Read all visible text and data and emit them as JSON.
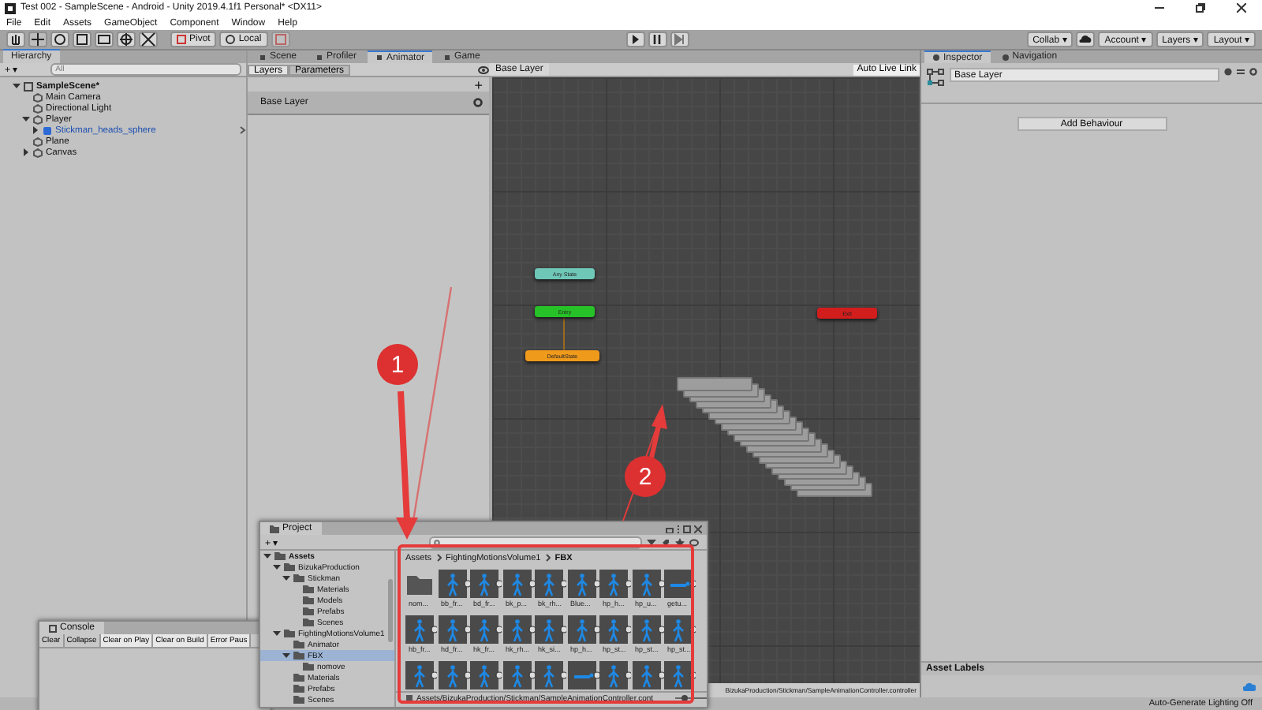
{
  "window": {
    "title": "Test 002 - SampleScene - Android - Unity 2019.4.1f1 Personal* <DX11>"
  },
  "menu": [
    "File",
    "Edit",
    "Assets",
    "GameObject",
    "Component",
    "Window",
    "Help"
  ],
  "toolbar": {
    "pivot": "Pivot",
    "local": "Local",
    "collab": "Collab ▾",
    "account": "Account ▾",
    "layers": "Layers ▾",
    "layout": "Layout ▾"
  },
  "hierarchy": {
    "title": "Hierarchy",
    "add": "+ ▾",
    "search_placeholder": "All",
    "items": [
      {
        "label": "SampleScene*",
        "kind": "scene",
        "expanded": true,
        "children": [
          {
            "label": "Main Camera",
            "kind": "object"
          },
          {
            "label": "Directional Light",
            "kind": "object"
          },
          {
            "label": "Player",
            "kind": "object",
            "expanded": true,
            "children": [
              {
                "label": "Stickman_heads_sphere",
                "kind": "prefab",
                "expanded": false
              }
            ]
          },
          {
            "label": "Plane",
            "kind": "object"
          },
          {
            "label": "Canvas",
            "kind": "object",
            "expanded": false
          }
        ]
      }
    ]
  },
  "center_tabs": [
    {
      "label": "Scene",
      "selected": false
    },
    {
      "label": "Profiler",
      "selected": false
    },
    {
      "label": "Animator",
      "selected": true
    },
    {
      "label": "Game",
      "selected": false
    }
  ],
  "animator": {
    "subtabs": [
      {
        "label": "Layers",
        "selected": true
      },
      {
        "label": "Parameters",
        "selected": false
      }
    ],
    "add": "+",
    "layer": "Base Layer",
    "breadcrumb": "Base Layer",
    "live_link": "Auto Live Link",
    "nodes": [
      {
        "label": "Any State",
        "kind": "any_state"
      },
      {
        "label": "Entry",
        "kind": "entry"
      },
      {
        "label": "DefaultState",
        "kind": "default"
      },
      {
        "label": "Exit",
        "kind": "exit"
      },
      {
        "kind": "stack"
      }
    ],
    "path": "BizukaProduction/Stickman/SampleAnimationController.controller"
  },
  "inspector": {
    "tabs": [
      {
        "label": "Inspector",
        "selected": true
      },
      {
        "label": "Navigation",
        "selected": false
      }
    ],
    "name": "Base Layer",
    "button": "Add Behaviour",
    "asset_labels": "Asset Labels"
  },
  "project": {
    "title": "Project",
    "add": "+ ▾",
    "tree": [
      {
        "label": "Assets",
        "expanded": true,
        "selected": false,
        "children": [
          {
            "label": "BizukaProduction",
            "expanded": true,
            "selected": false,
            "children": [
              {
                "label": "Stickman",
                "expanded": true,
                "selected": false,
                "children": [
                  {
                    "label": "Materials",
                    "selected": false
                  },
                  {
                    "label": "Models",
                    "selected": false
                  },
                  {
                    "label": "Prefabs",
                    "selected": false
                  },
                  {
                    "label": "Scenes",
                    "selected": false
                  }
                ]
              }
            ]
          },
          {
            "label": "FightingMotionsVolume1",
            "expanded": true,
            "selected": false,
            "children": [
              {
                "label": "Animator",
                "selected": false
              },
              {
                "label": "FBX",
                "expanded": true,
                "selected": true,
                "children": [
                  {
                    "label": "nomove",
                    "selected": false
                  }
                ]
              },
              {
                "label": "Materials",
                "selected": false
              },
              {
                "label": "Prefabs",
                "selected": false
              },
              {
                "label": "Scenes",
                "selected": false
              }
            ]
          }
        ]
      }
    ],
    "breadcrumb": [
      "Assets",
      "FightingMotionsVolume1",
      "FBX"
    ],
    "assets": [
      {
        "label": "nom...",
        "kind": "folder"
      },
      {
        "label": "bb_fr...",
        "kind": "model"
      },
      {
        "label": "bd_fr...",
        "kind": "model"
      },
      {
        "label": "bk_p...",
        "kind": "model"
      },
      {
        "label": "bk_rh...",
        "kind": "model"
      },
      {
        "label": "Blue...",
        "kind": "model"
      },
      {
        "label": "hp_h...",
        "kind": "model"
      },
      {
        "label": "hp_u...",
        "kind": "model"
      },
      {
        "label": "getu...",
        "kind": "lying"
      },
      {
        "label": "hb_fr...",
        "kind": "model"
      },
      {
        "label": "hd_fr...",
        "kind": "model"
      },
      {
        "label": "hk_fr...",
        "kind": "model"
      },
      {
        "label": "hk_rh...",
        "kind": "model"
      },
      {
        "label": "hk_si...",
        "kind": "model"
      },
      {
        "label": "hp_h...",
        "kind": "model"
      },
      {
        "label": "hp_st...",
        "kind": "model"
      },
      {
        "label": "hp_st...",
        "kind": "model"
      },
      {
        "label": "hp_st...",
        "kind": "model"
      },
      {
        "kind": "model"
      },
      {
        "kind": "model"
      },
      {
        "kind": "model"
      },
      {
        "kind": "model"
      },
      {
        "kind": "model"
      },
      {
        "kind": "lying"
      },
      {
        "kind": "model"
      },
      {
        "kind": "model"
      },
      {
        "kind": "model"
      }
    ],
    "path": "Assets/BizukaProduction/Stickman/SampleAnimationController.cont"
  },
  "console": {
    "title": "Console",
    "buttons": [
      "Clear",
      "Collapse",
      "Clear on Play",
      "Clear on Build",
      "Error Paus"
    ]
  },
  "annotations": [
    {
      "label": "1"
    },
    {
      "label": "2"
    }
  ],
  "status_bar": {
    "lighting": "Auto-Generate Lighting Off"
  }
}
